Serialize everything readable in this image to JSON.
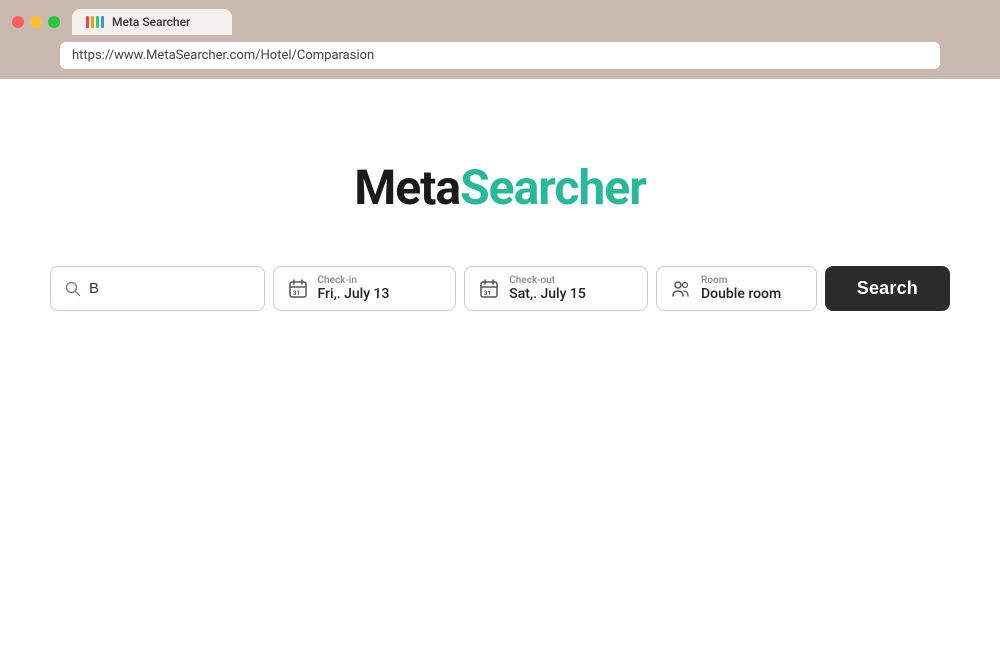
{
  "browser": {
    "tab_title": "Meta Searcher",
    "url": "https://www.MetaSearcher.com/Hotel/Comparasion"
  },
  "logo": {
    "meta": "Meta",
    "searcher": "Searcher"
  },
  "search_bar": {
    "location_placeholder": "B",
    "checkin_label": "Check-in",
    "checkin_value": "Fri,. July 13",
    "checkout_label": "Check-out",
    "checkout_value": "Sat,. July 15",
    "room_label": "Room",
    "room_value": "Double room",
    "search_button": "Search"
  },
  "favicon": {
    "colors": [
      "#e74c3c",
      "#f39c12",
      "#2ecc71",
      "#3498db"
    ]
  }
}
